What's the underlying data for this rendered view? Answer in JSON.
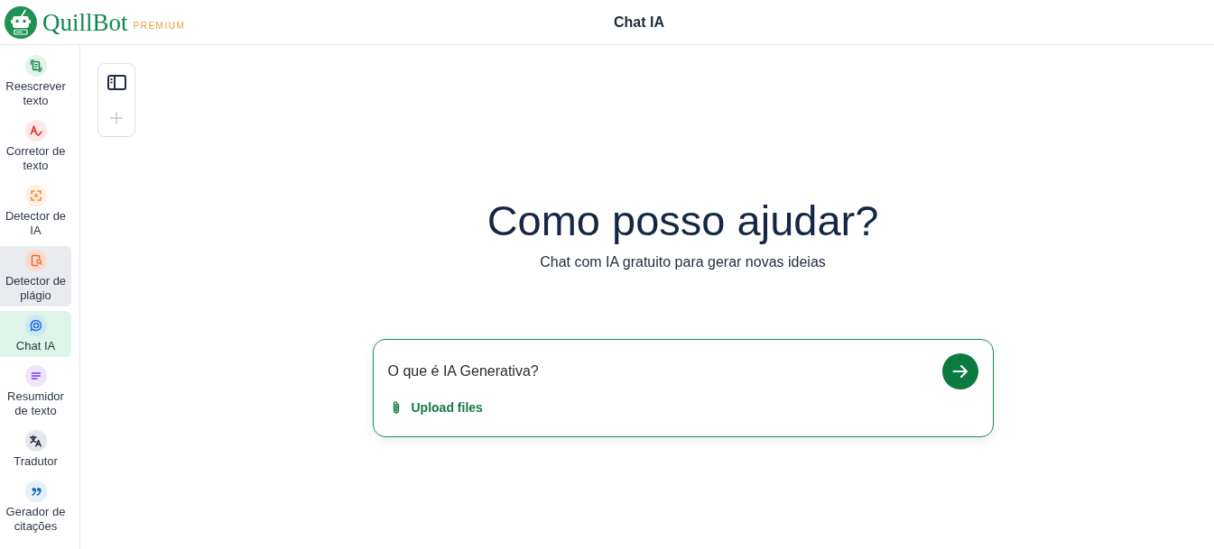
{
  "header": {
    "logo": {
      "wordmark": "QuillBot",
      "plan": "PREMIUM"
    },
    "title": "Chat IA"
  },
  "sidebar": {
    "items": [
      {
        "label": "Reescrever texto",
        "kind": "rewrite",
        "selected": false,
        "hovered": false
      },
      {
        "label": "Corretor de texto",
        "kind": "grammar",
        "selected": false,
        "hovered": false
      },
      {
        "label": "Detector de IA",
        "kind": "ai-detector",
        "selected": false,
        "hovered": false
      },
      {
        "label": "Detector de plágio",
        "kind": "plagiarism",
        "selected": false,
        "hovered": true
      },
      {
        "label": "Chat IA",
        "kind": "chat",
        "selected": true,
        "hovered": false
      },
      {
        "label": "Resumidor de texto",
        "kind": "summarizer",
        "selected": false,
        "hovered": false
      },
      {
        "label": "Tradutor",
        "kind": "translator",
        "selected": false,
        "hovered": false
      },
      {
        "label": "Gerador de citações",
        "kind": "citation",
        "selected": false,
        "hovered": false
      }
    ]
  },
  "toolbar": {
    "new_chat": {
      "disabled": true
    }
  },
  "hero": {
    "title": "Como posso ajudar?",
    "subtitle": "Chat com IA gratuito para gerar novas ideias"
  },
  "composer": {
    "value": "O que é IA Generativa?",
    "upload_label": "Upload files"
  }
}
